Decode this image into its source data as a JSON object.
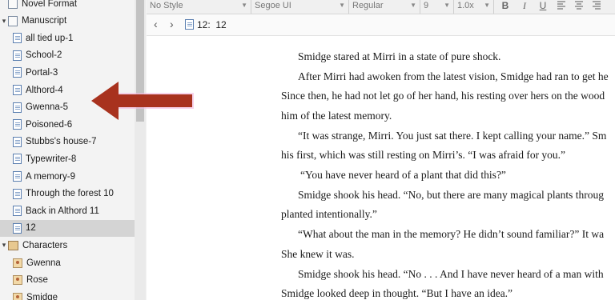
{
  "sidebar": {
    "items": [
      {
        "label": "Novel Format",
        "icon": "book-icon",
        "indent": 0,
        "chevron": ""
      },
      {
        "label": "Manuscript",
        "icon": "book-icon",
        "indent": 0,
        "chevron": "▾"
      },
      {
        "label": "all tied up-1",
        "icon": "document-icon",
        "indent": 1
      },
      {
        "label": "School-2",
        "icon": "document-icon",
        "indent": 1
      },
      {
        "label": "Portal-3",
        "icon": "document-icon",
        "indent": 1
      },
      {
        "label": "Althord-4",
        "icon": "document-icon",
        "indent": 1
      },
      {
        "label": "Gwenna-5",
        "icon": "document-icon",
        "indent": 1
      },
      {
        "label": "Poisoned-6",
        "icon": "document-icon",
        "indent": 1
      },
      {
        "label": "Stubbs's house-7",
        "icon": "document-icon",
        "indent": 1
      },
      {
        "label": "Typewriter-8",
        "icon": "document-icon",
        "indent": 1
      },
      {
        "label": "A memory-9",
        "icon": "document-icon",
        "indent": 1
      },
      {
        "label": "Through the forest 10",
        "icon": "document-icon",
        "indent": 1
      },
      {
        "label": "Back in Althord 11",
        "icon": "document-icon",
        "indent": 1
      },
      {
        "label": "12",
        "icon": "document-icon",
        "indent": 1,
        "selected": true
      },
      {
        "label": "Characters",
        "icon": "characters-folder-icon",
        "indent": 0,
        "chevron": "▾"
      },
      {
        "label": "Gwenna",
        "icon": "character-icon",
        "indent": 1
      },
      {
        "label": "Rose",
        "icon": "character-icon",
        "indent": 1
      },
      {
        "label": "Smidge",
        "icon": "character-icon",
        "indent": 1
      }
    ]
  },
  "toolbar": {
    "style": "No Style",
    "font": "Segoe UI",
    "weight": "Regular",
    "size": "9",
    "spacing": "1.0x",
    "bold": "B",
    "italic": "I",
    "underline": "U"
  },
  "navbar": {
    "back": "‹",
    "forward": "›",
    "title": "12:  12"
  },
  "document": {
    "paragraphs": [
      "Smidge stared at Mirri in a state of pure shock.",
      "After Mirri had awoken from the latest vision, Smidge had ran to get he",
      "Since then, he had not let go of her hand, his resting over hers on the wood",
      "him of the latest memory.",
      "“It was strange, Mirri. You just sat there. I kept calling your name.” Sm",
      "his first, which was still resting on Mirri’s. “I was afraid for you.”",
      "“You have never heard of a plant that did this?”",
      "Smidge shook his head. “No, but there are many magical plants throug",
      "planted intentionally.”",
      "“What about the man in the memory? He didn’t sound familiar?” It wa",
      "She knew it was.",
      "Smidge shook his head. “No . . . And I have never heard of a man with",
      "Smidge looked deep in thought. “But I have an idea.”"
    ]
  },
  "colors": {
    "arrow": "#a8321e",
    "selection": "#d4d4d4",
    "sidebar_bg": "#f3f3f3"
  }
}
